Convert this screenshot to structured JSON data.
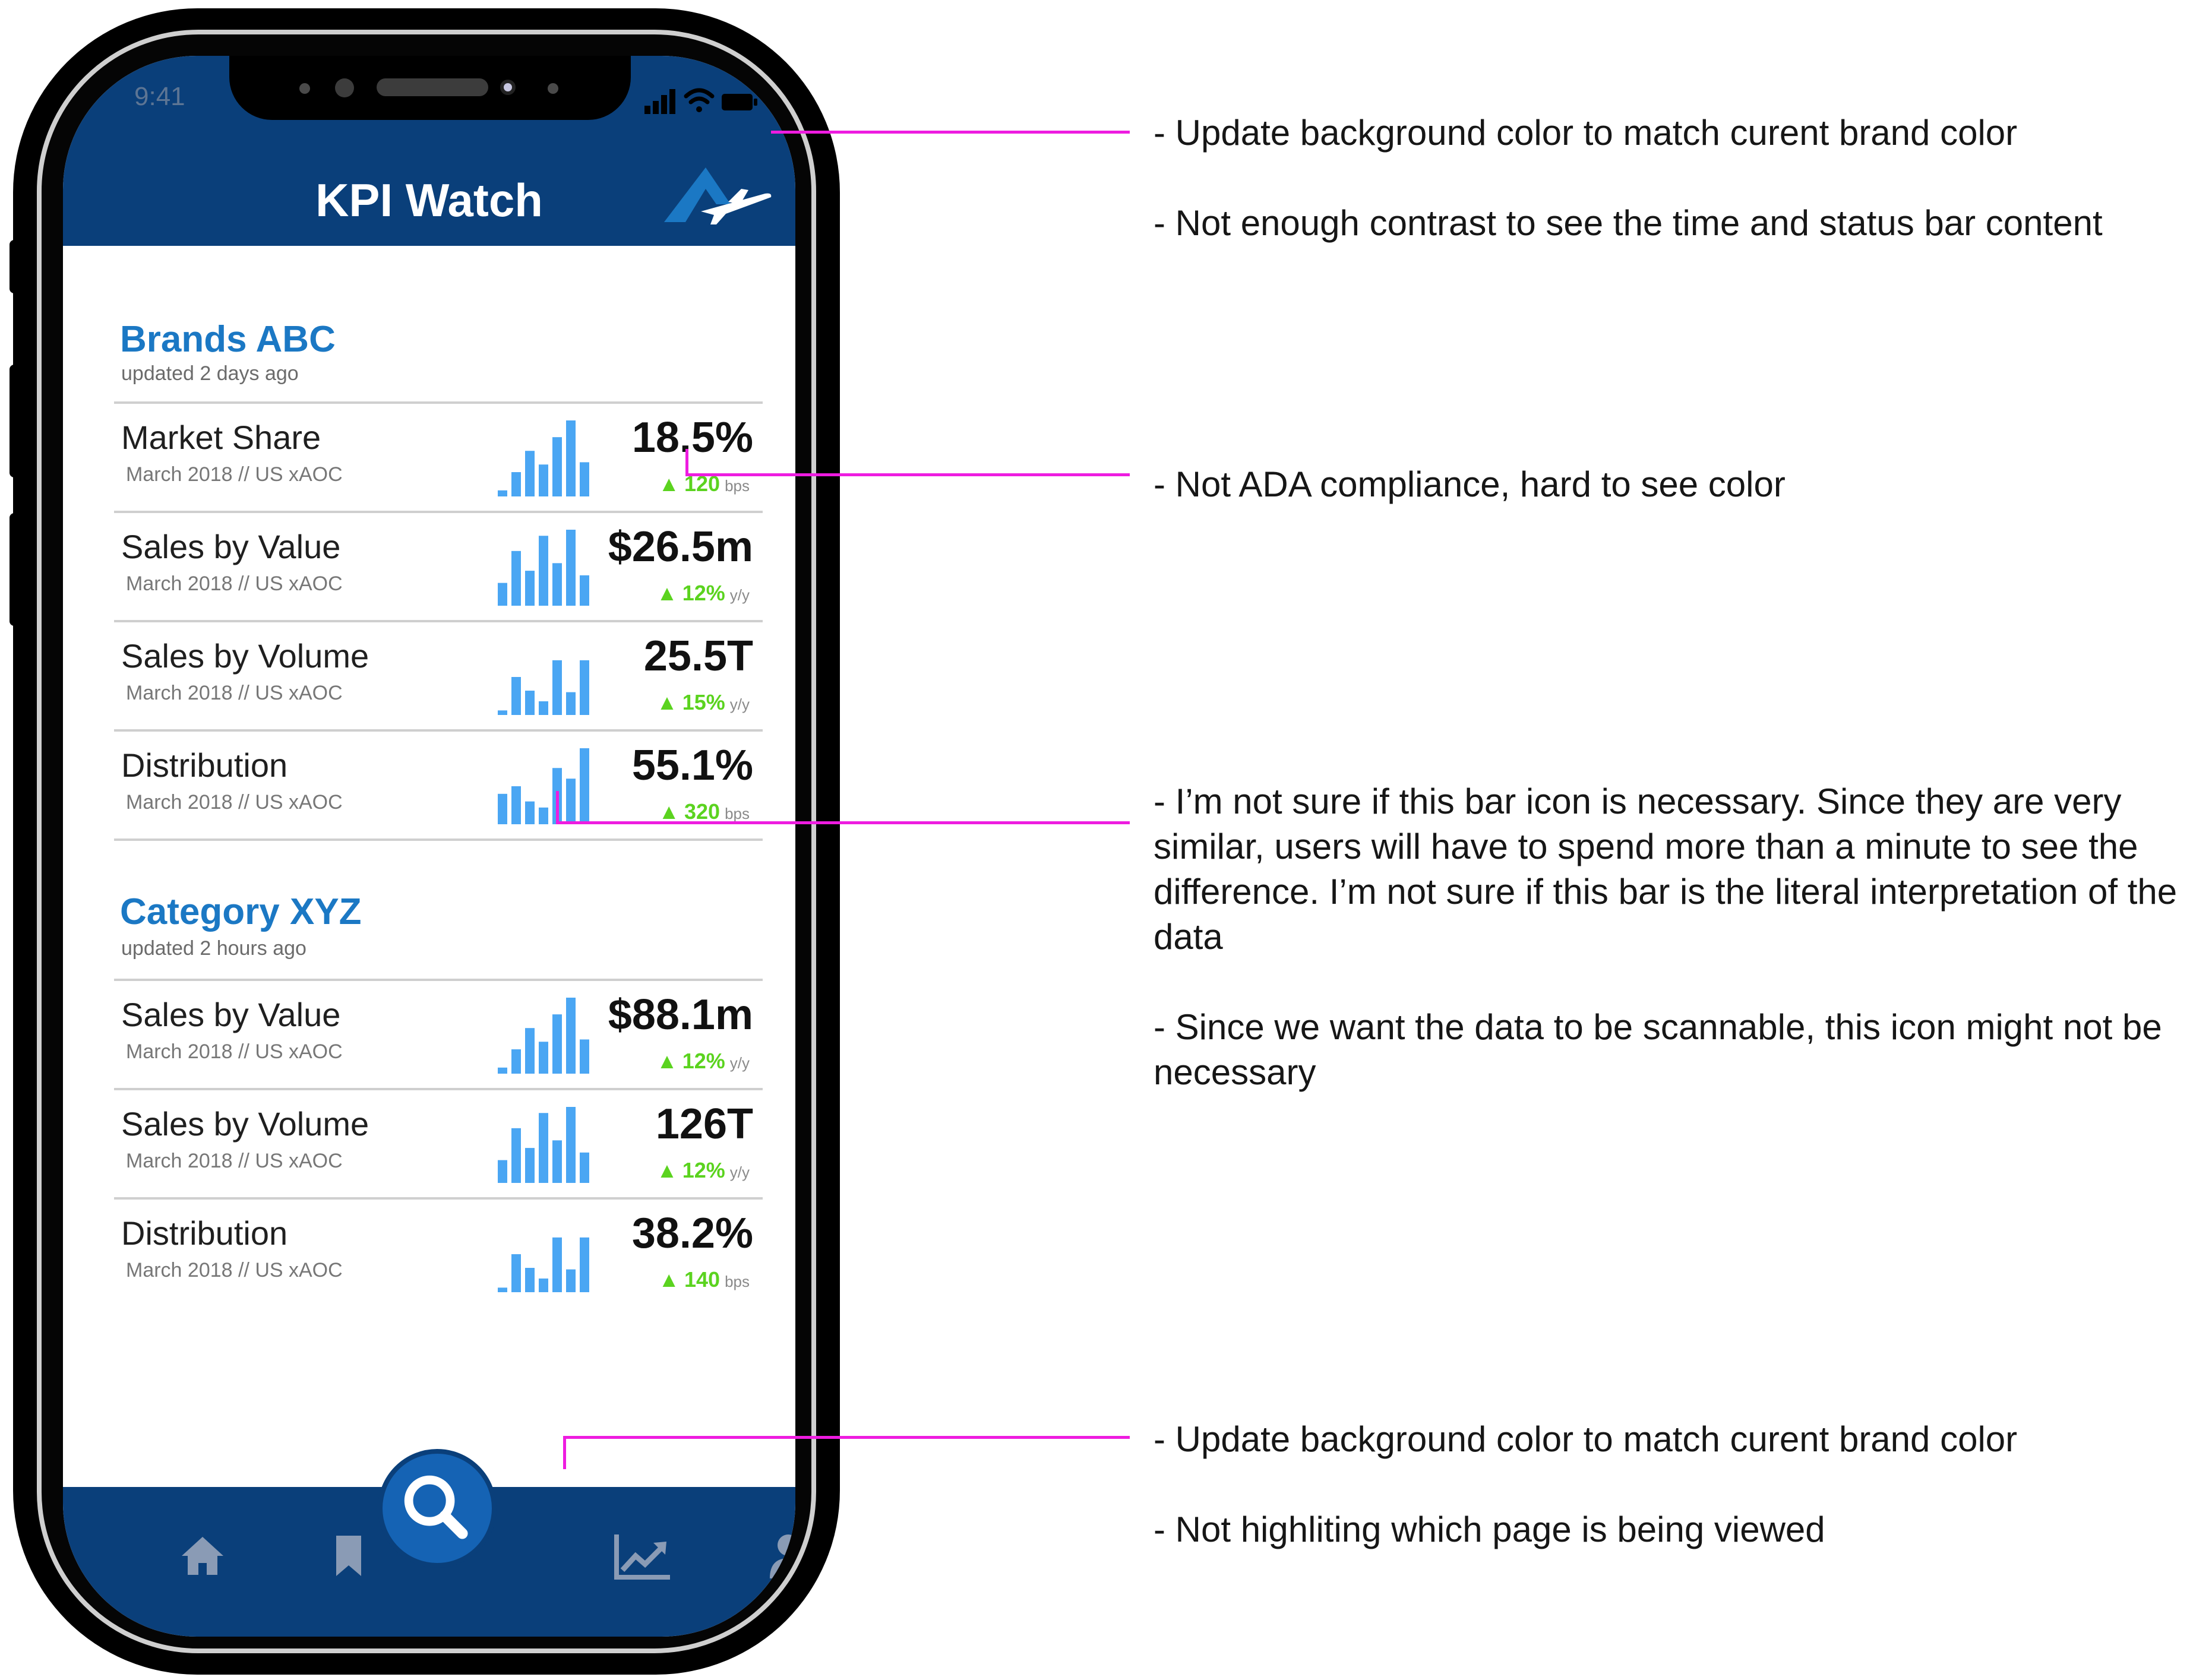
{
  "status_bar": {
    "time": "9:41"
  },
  "header": {
    "title": "KPI Watch"
  },
  "sections": [
    {
      "title": "Brands ABC",
      "updated": "updated 2 days ago",
      "rows": [
        {
          "name": "Market Share",
          "meta": "March 2018 // US xAOC",
          "value": "18.5%",
          "delta": "120",
          "unit": "bps"
        },
        {
          "name": "Sales by Value",
          "meta": "March 2018 // US xAOC",
          "value": "$26.5m",
          "delta": "12%",
          "unit": "y/y"
        },
        {
          "name": "Sales by Volume",
          "meta": "March 2018 // US xAOC",
          "value": "25.5T",
          "delta": "15%",
          "unit": "y/y"
        },
        {
          "name": "Distribution",
          "meta": "March 2018 // US xAOC",
          "value": "55.1%",
          "delta": "320",
          "unit": "bps"
        }
      ]
    },
    {
      "title": "Category XYZ",
      "updated": "updated 2 hours ago",
      "rows": [
        {
          "name": "Sales by Value",
          "meta": "March 2018 // US xAOC",
          "value": "$88.1m",
          "delta": "12%",
          "unit": "y/y"
        },
        {
          "name": "Sales by Volume",
          "meta": "March 2018 // US xAOC",
          "value": "126T",
          "delta": "12%",
          "unit": "y/y"
        },
        {
          "name": "Distribution",
          "meta": "March 2018 // US xAOC",
          "value": "38.2%",
          "delta": "140",
          "unit": "bps"
        }
      ]
    }
  ],
  "tabbar": {
    "items": [
      "home-icon",
      "bookmark-icon",
      "search-icon",
      "trend-chart-icon",
      "user-icon"
    ]
  },
  "annotations": [
    "- Update background color to match curent brand color\n\n- Not enough contrast to see the time and status bar content",
    "- Not ADA compliance, hard to see color",
    "- I’m not sure if this bar icon is necessary. Since they are very similar, users will have to spend more than a minute to see the difference. I’m not sure if this bar is the literal interpretation of the data\n\n- Since we want the data to be scannable, this icon might not be necessary",
    "- Update background color to match curent brand color\n\n- Not highliting which page is being viewed"
  ],
  "colors": {
    "brand_header": "#0a3f7a",
    "section_title": "#1b78c4",
    "delta_green": "#5bd31f",
    "spark_bar": "#4aa6f3",
    "annotation_line": "#ee1ce0"
  }
}
